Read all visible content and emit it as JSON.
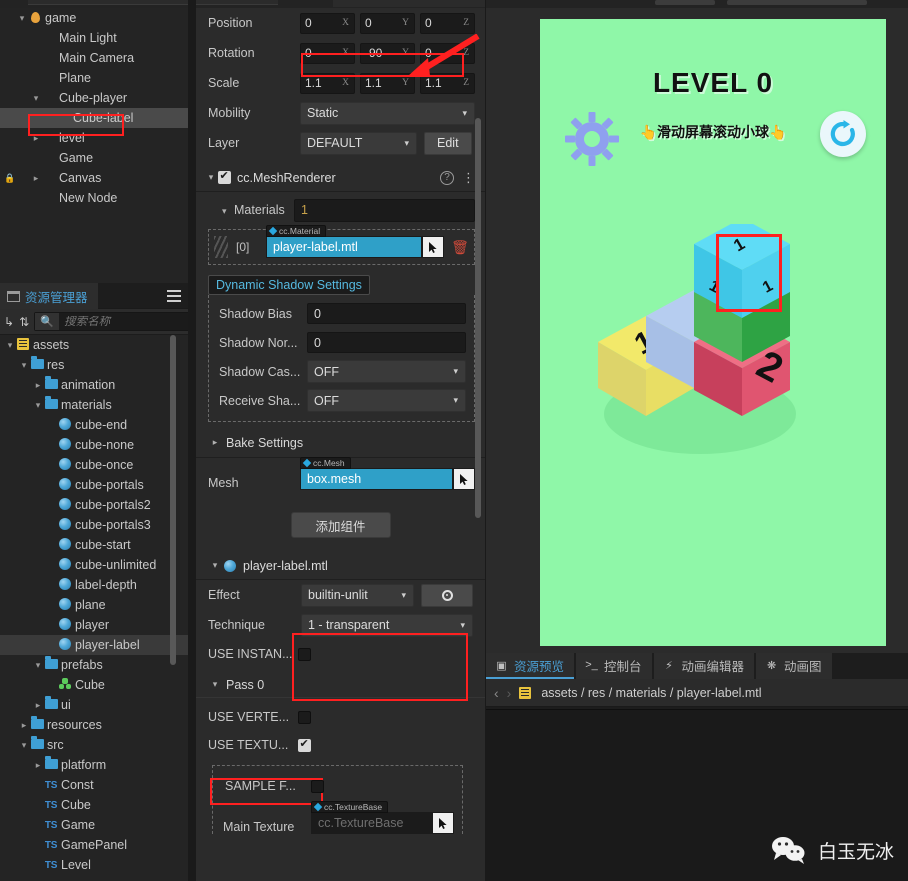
{
  "hierarchy": {
    "nodes": [
      {
        "label": "game",
        "depth": 0,
        "arrow": "down",
        "icon": "flame-icon",
        "selected": false,
        "locked": false
      },
      {
        "label": "Main Light",
        "depth": 1,
        "arrow": "none",
        "icon": "none",
        "selected": false,
        "locked": false
      },
      {
        "label": "Main Camera",
        "depth": 1,
        "arrow": "none",
        "icon": "none",
        "selected": false,
        "locked": false
      },
      {
        "label": "Plane",
        "depth": 1,
        "arrow": "none",
        "icon": "none",
        "selected": false,
        "locked": false
      },
      {
        "label": "Cube-player",
        "depth": 1,
        "arrow": "down",
        "icon": "none",
        "selected": false,
        "locked": false
      },
      {
        "label": "Cube-label",
        "depth": 2,
        "arrow": "none",
        "icon": "none",
        "selected": true,
        "locked": false
      },
      {
        "label": "level",
        "depth": 1,
        "arrow": "right",
        "icon": "none",
        "selected": false,
        "locked": false
      },
      {
        "label": "Game",
        "depth": 1,
        "arrow": "none",
        "icon": "none",
        "selected": false,
        "locked": false
      },
      {
        "label": "Canvas",
        "depth": 1,
        "arrow": "right",
        "icon": "none",
        "selected": false,
        "locked": true
      },
      {
        "label": "New Node",
        "depth": 1,
        "arrow": "none",
        "icon": "none",
        "selected": false,
        "locked": false
      }
    ]
  },
  "assets": {
    "tab_label": "资源管理器",
    "search_placeholder": "搜索名称",
    "tree": [
      {
        "label": "assets",
        "depth": 0,
        "arrow": "down",
        "icon": "assets-db-icon",
        "selected": false
      },
      {
        "label": "res",
        "depth": 1,
        "arrow": "down",
        "icon": "folder-icon",
        "selected": false
      },
      {
        "label": "animation",
        "depth": 2,
        "arrow": "right",
        "icon": "folder-icon",
        "selected": false
      },
      {
        "label": "materials",
        "depth": 2,
        "arrow": "down",
        "icon": "folder-icon",
        "selected": false
      },
      {
        "label": "cube-end",
        "depth": 3,
        "arrow": "none",
        "icon": "material-icon",
        "selected": false
      },
      {
        "label": "cube-none",
        "depth": 3,
        "arrow": "none",
        "icon": "material-icon",
        "selected": false
      },
      {
        "label": "cube-once",
        "depth": 3,
        "arrow": "none",
        "icon": "material-icon",
        "selected": false
      },
      {
        "label": "cube-portals",
        "depth": 3,
        "arrow": "none",
        "icon": "material-icon",
        "selected": false
      },
      {
        "label": "cube-portals2",
        "depth": 3,
        "arrow": "none",
        "icon": "material-icon",
        "selected": false
      },
      {
        "label": "cube-portals3",
        "depth": 3,
        "arrow": "none",
        "icon": "material-icon",
        "selected": false
      },
      {
        "label": "cube-start",
        "depth": 3,
        "arrow": "none",
        "icon": "material-icon",
        "selected": false
      },
      {
        "label": "cube-unlimited",
        "depth": 3,
        "arrow": "none",
        "icon": "material-icon",
        "selected": false
      },
      {
        "label": "label-depth",
        "depth": 3,
        "arrow": "none",
        "icon": "material-icon",
        "selected": false
      },
      {
        "label": "plane",
        "depth": 3,
        "arrow": "none",
        "icon": "material-icon",
        "selected": false
      },
      {
        "label": "player",
        "depth": 3,
        "arrow": "none",
        "icon": "material-icon",
        "selected": false
      },
      {
        "label": "player-label",
        "depth": 3,
        "arrow": "none",
        "icon": "material-icon",
        "selected": true
      },
      {
        "label": "prefabs",
        "depth": 2,
        "arrow": "down",
        "icon": "folder-icon",
        "selected": false
      },
      {
        "label": "Cube",
        "depth": 3,
        "arrow": "none",
        "icon": "prefab-icon",
        "selected": false
      },
      {
        "label": "ui",
        "depth": 2,
        "arrow": "right",
        "icon": "folder-icon",
        "selected": false
      },
      {
        "label": "resources",
        "depth": 1,
        "arrow": "right",
        "icon": "folder-icon",
        "selected": false
      },
      {
        "label": "src",
        "depth": 1,
        "arrow": "down",
        "icon": "folder-icon",
        "selected": false
      },
      {
        "label": "platform",
        "depth": 2,
        "arrow": "right",
        "icon": "folder-icon",
        "selected": false
      },
      {
        "label": "Const",
        "depth": 2,
        "arrow": "none",
        "icon": "ts-icon",
        "selected": false
      },
      {
        "label": "Cube",
        "depth": 2,
        "arrow": "none",
        "icon": "ts-icon",
        "selected": false
      },
      {
        "label": "Game",
        "depth": 2,
        "arrow": "none",
        "icon": "ts-icon",
        "selected": false
      },
      {
        "label": "GamePanel",
        "depth": 2,
        "arrow": "none",
        "icon": "ts-icon",
        "selected": false
      },
      {
        "label": "Level",
        "depth": 2,
        "arrow": "none",
        "icon": "ts-icon",
        "selected": false
      }
    ]
  },
  "inspector": {
    "transform": {
      "position_label": "Position",
      "position": {
        "x": "0",
        "y": "0",
        "z": "0"
      },
      "rotation_label": "Rotation",
      "rotation": {
        "x": "0",
        "y": "-90",
        "z": "0"
      },
      "scale_label": "Scale",
      "scale": {
        "x": "1.1",
        "y": "1.1",
        "z": "1.1"
      },
      "mobility_label": "Mobility",
      "mobility_value": "Static",
      "layer_label": "Layer",
      "layer_value": "DEFAULT",
      "layer_edit_label": "Edit",
      "axis_x": "X",
      "axis_y": "Y",
      "axis_z": "Z"
    },
    "mesh_renderer": {
      "title": "cc.MeshRenderer",
      "materials_label": "Materials",
      "materials_count": "1",
      "material_index": "[0]",
      "material_type_tag": "cc.Material",
      "material_value": "player-label.mtl",
      "shadow_section_title": "Dynamic Shadow Settings",
      "shadow_rows": [
        {
          "label": "Shadow Bias",
          "value": "0",
          "kind": "input"
        },
        {
          "label": "Shadow Nor...",
          "value": "0",
          "kind": "input"
        },
        {
          "label": "Shadow Cas...",
          "value": "OFF",
          "kind": "select"
        },
        {
          "label": "Receive Sha...",
          "value": "OFF",
          "kind": "select"
        }
      ],
      "bake_settings_label": "Bake Settings",
      "mesh_label": "Mesh",
      "mesh_type_tag": "cc.Mesh",
      "mesh_value": "box.mesh"
    },
    "add_component_label": "添加组件",
    "material_panel": {
      "title": "player-label.mtl",
      "effect_label": "Effect",
      "effect_value": "builtin-unlit",
      "technique_label": "Technique",
      "technique_value": "1 - transparent",
      "use_instancing_label": "USE INSTAN...",
      "use_instancing_checked": false,
      "pass_label": "Pass 0",
      "use_vertex_label": "USE VERTE...",
      "use_vertex_checked": false,
      "use_texture_label": "USE TEXTU...",
      "use_texture_checked": true,
      "sample_from_label": "SAMPLE F...",
      "sample_from_checked": false,
      "main_texture_label": "Main Texture",
      "main_texture_type_tag": "cc.TextureBase",
      "main_texture_value": "cc.TextureBase"
    }
  },
  "game": {
    "level_title": "LEVEL 0",
    "hint_text": "滑动屏幕滚动小球",
    "hint_emoji": "👆",
    "gear_icon_name": "settings-gear-icon",
    "refresh_icon_name": "restart-icon",
    "background_color": "#8ff7a8",
    "cubes": [
      {
        "face": "top",
        "label": "1",
        "color": "#4fd0ee",
        "name": "player-cube"
      },
      {
        "face": "top",
        "label": "1",
        "color": "#f2e96a",
        "name": "cube-yellow"
      },
      {
        "face": "front",
        "label": "2",
        "color": "#e0556e",
        "name": "cube-red"
      }
    ]
  },
  "bottom_dock": {
    "tabs": [
      {
        "label": "资源预览",
        "icon": "preview-icon",
        "active": true
      },
      {
        "label": "控制台",
        "icon": "console-icon",
        "active": false
      },
      {
        "label": "动画编辑器",
        "icon": "animation-editor-icon",
        "active": false
      },
      {
        "label": "动画图",
        "icon": "animation-graph-icon",
        "active": false
      }
    ],
    "breadcrumb": "assets / res / materials / player-label.mtl",
    "back_label": "‹",
    "forward_label": "›"
  },
  "watermark": {
    "text": "白玉无冰",
    "icon": "wechat-icon"
  }
}
